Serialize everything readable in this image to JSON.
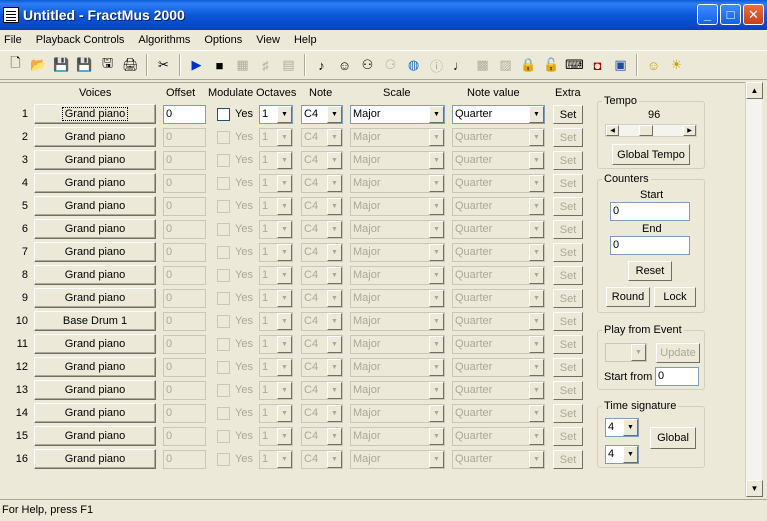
{
  "window": {
    "title": "Untitled - FractMus 2000"
  },
  "menu": [
    "File",
    "Playback Controls",
    "Algorithms",
    "Options",
    "View",
    "Help"
  ],
  "toolbar": [
    {
      "icon": "new-file-icon",
      "glyph": "🗋",
      "enabled": true
    },
    {
      "icon": "open-folder-icon",
      "glyph": "📂",
      "enabled": true
    },
    {
      "icon": "save-icon",
      "glyph": "💾",
      "enabled": true
    },
    {
      "icon": "save-as-icon",
      "glyph": "💾",
      "enabled": true
    },
    {
      "icon": "export-icon",
      "glyph": "🖫",
      "enabled": true
    },
    {
      "icon": "print-icon",
      "glyph": "🖨",
      "enabled": true
    },
    {
      "sep": true
    },
    {
      "icon": "cut-icon",
      "glyph": "✂",
      "enabled": true
    },
    {
      "sep": true
    },
    {
      "icon": "play-icon",
      "glyph": "▶",
      "enabled": true,
      "color": "#0033cc"
    },
    {
      "icon": "stop-icon",
      "glyph": "■",
      "enabled": true
    },
    {
      "icon": "grid-icon",
      "glyph": "▦",
      "enabled": false
    },
    {
      "icon": "score-icon",
      "glyph": "♯",
      "enabled": false
    },
    {
      "icon": "table-icon",
      "glyph": "▤",
      "enabled": false
    },
    {
      "sep": true
    },
    {
      "icon": "music-note-icon",
      "glyph": "♪",
      "enabled": true
    },
    {
      "icon": "musician-icon",
      "glyph": "☺",
      "enabled": true
    },
    {
      "icon": "people-icon",
      "glyph": "⚇",
      "enabled": true
    },
    {
      "icon": "users-icon",
      "glyph": "⚆",
      "enabled": false
    },
    {
      "icon": "globe-icon",
      "glyph": "◍",
      "enabled": true,
      "color": "#1a6fbf"
    },
    {
      "icon": "info-icon",
      "glyph": "ⓘ",
      "enabled": false
    },
    {
      "icon": "eighth-note-icon",
      "glyph": "♩",
      "enabled": true
    },
    {
      "icon": "chart-icon",
      "glyph": "▩",
      "enabled": false
    },
    {
      "icon": "image-icon",
      "glyph": "▨",
      "enabled": false
    },
    {
      "icon": "lock-icon",
      "glyph": "🔒",
      "enabled": true
    },
    {
      "icon": "padlock-icon",
      "glyph": "🔓",
      "enabled": false
    },
    {
      "icon": "keyboard-icon",
      "glyph": "⌨",
      "enabled": true
    },
    {
      "icon": "speakers-icon",
      "glyph": "◘",
      "enabled": true,
      "color": "#a00000"
    },
    {
      "icon": "monitor-icon",
      "glyph": "▣",
      "enabled": true,
      "color": "#1a4fa0"
    },
    {
      "sep": true
    },
    {
      "icon": "smiley-icon",
      "glyph": "☺",
      "enabled": true,
      "color": "#c9a000"
    },
    {
      "icon": "lightbulb-icon",
      "glyph": "☀",
      "enabled": true,
      "color": "#c9a000"
    }
  ],
  "headers": {
    "voices": "Voices",
    "offset": "Offset",
    "modulate": "Modulate",
    "octaves": "Octaves",
    "note": "Note",
    "scale": "Scale",
    "note_value": "Note value",
    "extra": "Extra"
  },
  "rows": [
    {
      "num": "1",
      "voice": "Grand piano",
      "offset": "0",
      "yes": "Yes",
      "octaves": "1",
      "note": "C4",
      "scale": "Major",
      "note_value": "Quarter",
      "set": "Set",
      "enabled": true
    },
    {
      "num": "2",
      "voice": "Grand piano",
      "offset": "0",
      "yes": "Yes",
      "octaves": "1",
      "note": "C4",
      "scale": "Major",
      "note_value": "Quarter",
      "set": "Set",
      "enabled": false
    },
    {
      "num": "3",
      "voice": "Grand piano",
      "offset": "0",
      "yes": "Yes",
      "octaves": "1",
      "note": "C4",
      "scale": "Major",
      "note_value": "Quarter",
      "set": "Set",
      "enabled": false
    },
    {
      "num": "4",
      "voice": "Grand piano",
      "offset": "0",
      "yes": "Yes",
      "octaves": "1",
      "note": "C4",
      "scale": "Major",
      "note_value": "Quarter",
      "set": "Set",
      "enabled": false
    },
    {
      "num": "5",
      "voice": "Grand piano",
      "offset": "0",
      "yes": "Yes",
      "octaves": "1",
      "note": "C4",
      "scale": "Major",
      "note_value": "Quarter",
      "set": "Set",
      "enabled": false
    },
    {
      "num": "6",
      "voice": "Grand piano",
      "offset": "0",
      "yes": "Yes",
      "octaves": "1",
      "note": "C4",
      "scale": "Major",
      "note_value": "Quarter",
      "set": "Set",
      "enabled": false
    },
    {
      "num": "7",
      "voice": "Grand piano",
      "offset": "0",
      "yes": "Yes",
      "octaves": "1",
      "note": "C4",
      "scale": "Major",
      "note_value": "Quarter",
      "set": "Set",
      "enabled": false
    },
    {
      "num": "8",
      "voice": "Grand piano",
      "offset": "0",
      "yes": "Yes",
      "octaves": "1",
      "note": "C4",
      "scale": "Major",
      "note_value": "Quarter",
      "set": "Set",
      "enabled": false
    },
    {
      "num": "9",
      "voice": "Grand piano",
      "offset": "0",
      "yes": "Yes",
      "octaves": "1",
      "note": "C4",
      "scale": "Major",
      "note_value": "Quarter",
      "set": "Set",
      "enabled": false
    },
    {
      "num": "10",
      "voice": "Base Drum 1",
      "offset": "0",
      "yes": "Yes",
      "octaves": "1",
      "note": "C4",
      "scale": "Major",
      "note_value": "Quarter",
      "set": "Set",
      "enabled": false
    },
    {
      "num": "11",
      "voice": "Grand piano",
      "offset": "0",
      "yes": "Yes",
      "octaves": "1",
      "note": "C4",
      "scale": "Major",
      "note_value": "Quarter",
      "set": "Set",
      "enabled": false
    },
    {
      "num": "12",
      "voice": "Grand piano",
      "offset": "0",
      "yes": "Yes",
      "octaves": "1",
      "note": "C4",
      "scale": "Major",
      "note_value": "Quarter",
      "set": "Set",
      "enabled": false
    },
    {
      "num": "13",
      "voice": "Grand piano",
      "offset": "0",
      "yes": "Yes",
      "octaves": "1",
      "note": "C4",
      "scale": "Major",
      "note_value": "Quarter",
      "set": "Set",
      "enabled": false
    },
    {
      "num": "14",
      "voice": "Grand piano",
      "offset": "0",
      "yes": "Yes",
      "octaves": "1",
      "note": "C4",
      "scale": "Major",
      "note_value": "Quarter",
      "set": "Set",
      "enabled": false
    },
    {
      "num": "15",
      "voice": "Grand piano",
      "offset": "0",
      "yes": "Yes",
      "octaves": "1",
      "note": "C4",
      "scale": "Major",
      "note_value": "Quarter",
      "set": "Set",
      "enabled": false
    },
    {
      "num": "16",
      "voice": "Grand piano",
      "offset": "0",
      "yes": "Yes",
      "octaves": "1",
      "note": "C4",
      "scale": "Major",
      "note_value": "Quarter",
      "set": "Set",
      "enabled": false
    }
  ],
  "tempo": {
    "title": "Tempo",
    "value": "96",
    "level": 0.4,
    "global_button": "Global Tempo"
  },
  "counters": {
    "title": "Counters",
    "start_label": "Start",
    "start_value": "0",
    "end_label": "End",
    "end_value": "0",
    "reset_button": "Reset",
    "round_button": "Round",
    "lock_button": "Lock"
  },
  "play_from_event": {
    "title": "Play from Event",
    "update_button": "Update",
    "start_from_label": "Start from",
    "start_from_value": "0"
  },
  "time_signature": {
    "title": "Time signature",
    "numerator": "4",
    "denominator": "4",
    "global_button": "Global"
  },
  "status": {
    "text": "For Help, press F1"
  }
}
